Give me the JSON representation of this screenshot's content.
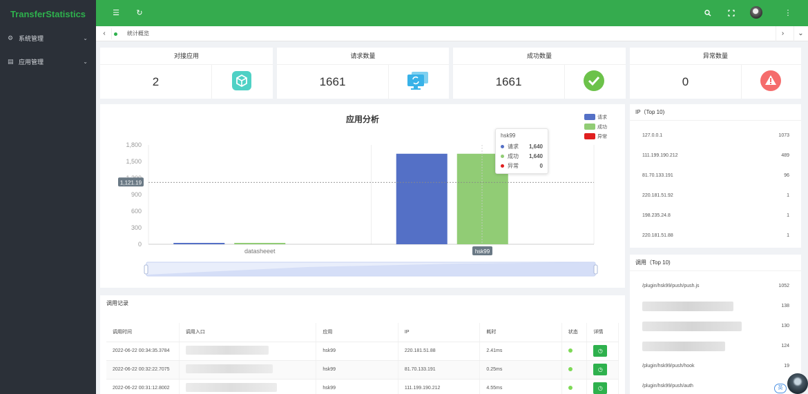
{
  "app": {
    "brand": "TransferStatistics"
  },
  "sidebar": {
    "items": [
      {
        "label": "系统管理",
        "icon": "gear-icon"
      },
      {
        "label": "应用管理",
        "icon": "app-icon"
      }
    ]
  },
  "tabs": {
    "active_label": "统计概览"
  },
  "stats": [
    {
      "title": "对接应用",
      "value": "2",
      "icon": "cube-icon",
      "color": "#4fd1c5"
    },
    {
      "title": "请求数量",
      "value": "1661",
      "icon": "monitor-refresh-icon",
      "color": "#38b2e8"
    },
    {
      "title": "成功数量",
      "value": "1661",
      "icon": "check-circle-icon",
      "color": "#6cc24a"
    },
    {
      "title": "异常数量",
      "value": "0",
      "icon": "warning-icon",
      "color": "#f56c6c"
    }
  ],
  "chart_data": {
    "type": "bar",
    "title": "应用分析",
    "categories": [
      "datasheeet",
      "hsk99"
    ],
    "series": [
      {
        "name": "请求",
        "values": [
          10,
          1640
        ],
        "color": "#5470c6"
      },
      {
        "name": "成功",
        "values": [
          10,
          1640
        ],
        "color": "#91cc75"
      },
      {
        "name": "异常",
        "values": [
          0,
          0
        ],
        "color": "#e01f1f"
      }
    ],
    "y_ticks": [
      "1,800",
      "1,500",
      "1,200",
      "900",
      "600",
      "300",
      "0"
    ],
    "ylim": [
      0,
      1800
    ],
    "crosshair_label": "1,121.19",
    "crosshair_value": 1121.19,
    "legend_position": "top-right",
    "tooltip": {
      "category": "hsk99",
      "rows": [
        {
          "name": "请求",
          "value": "1,640",
          "color": "#5470c6"
        },
        {
          "name": "成功",
          "value": "1,640",
          "color": "#91cc75"
        },
        {
          "name": "异常",
          "value": "0",
          "color": "#e01f1f"
        }
      ]
    },
    "axis_pointer_label": "hsk99"
  },
  "ip_top": {
    "title": "IP（Top 10)",
    "rows": [
      {
        "ip": "127.0.0.1",
        "count": "1073"
      },
      {
        "ip": "111.199.190.212",
        "count": "489"
      },
      {
        "ip": "81.70.133.191",
        "count": "96"
      },
      {
        "ip": "220.181.51.92",
        "count": "1"
      },
      {
        "ip": "198.235.24.8",
        "count": "1"
      },
      {
        "ip": "220.181.51.88",
        "count": "1"
      }
    ]
  },
  "call_top": {
    "title": "调用（Top 10)",
    "rows": [
      {
        "path": "/plugin/hsk99/push/push.js",
        "count": "1052"
      },
      {
        "path": "",
        "count": "138"
      },
      {
        "path": "",
        "count": "130"
      },
      {
        "path": "",
        "count": "124"
      },
      {
        "path": "/plugin/hsk99/push/hook",
        "count": "19"
      },
      {
        "path": "/plugin/hsk99/push/auth",
        "count": ""
      }
    ]
  },
  "records": {
    "title": "调用记录",
    "columns": [
      "调用时间",
      "调用入口",
      "应用",
      "IP",
      "耗时",
      "状态",
      "详情"
    ],
    "rows": [
      {
        "time": "2022-06-22 00:34:35.3784",
        "app": "hsk99",
        "ip": "220.181.51.88",
        "cost": "2.41ms"
      },
      {
        "time": "2022-06-22 00:32:22.7075",
        "app": "hsk99",
        "ip": "81.70.133.191",
        "cost": "0.25ms"
      },
      {
        "time": "2022-06-22 00:31:12.8002",
        "app": "hsk99",
        "ip": "111.199.190.212",
        "cost": "4.55ms"
      }
    ]
  },
  "float": {
    "badge": "英"
  }
}
